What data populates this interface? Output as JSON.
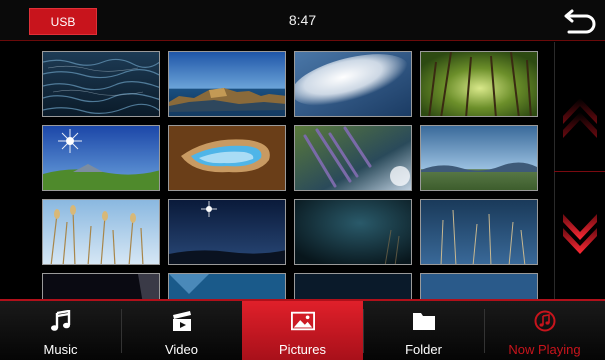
{
  "header": {
    "source_label": "USB",
    "clock": "8:47"
  },
  "gallery": {
    "thumbnails": [
      {
        "subject": "ocean-waves"
      },
      {
        "subject": "coastal-cliffs"
      },
      {
        "subject": "white-cloud"
      },
      {
        "subject": "green-forest"
      },
      {
        "subject": "sun-over-meadow"
      },
      {
        "subject": "sea-cave-arch"
      },
      {
        "subject": "lavender-stalks"
      },
      {
        "subject": "valley-horizon"
      },
      {
        "subject": "grass-seeds"
      },
      {
        "subject": "night-sky-star"
      },
      {
        "subject": "dark-water"
      },
      {
        "subject": "grass-silhouette"
      },
      {
        "subject": "dark-partial"
      },
      {
        "subject": "blue-partial"
      },
      {
        "subject": "dark-partial"
      },
      {
        "subject": "blue-partial"
      }
    ]
  },
  "bottom_nav": {
    "tabs": [
      {
        "label": "Music",
        "icon": "music-note-icon"
      },
      {
        "label": "Video",
        "icon": "clapperboard-icon"
      },
      {
        "label": "Pictures",
        "icon": "picture-icon",
        "active": true
      },
      {
        "label": "Folder",
        "icon": "folder-icon"
      },
      {
        "label": "Now Playing",
        "icon": "now-playing-icon"
      }
    ]
  },
  "colors": {
    "accent": "#c8141c",
    "background": "#000000",
    "text": "#ffffff"
  }
}
